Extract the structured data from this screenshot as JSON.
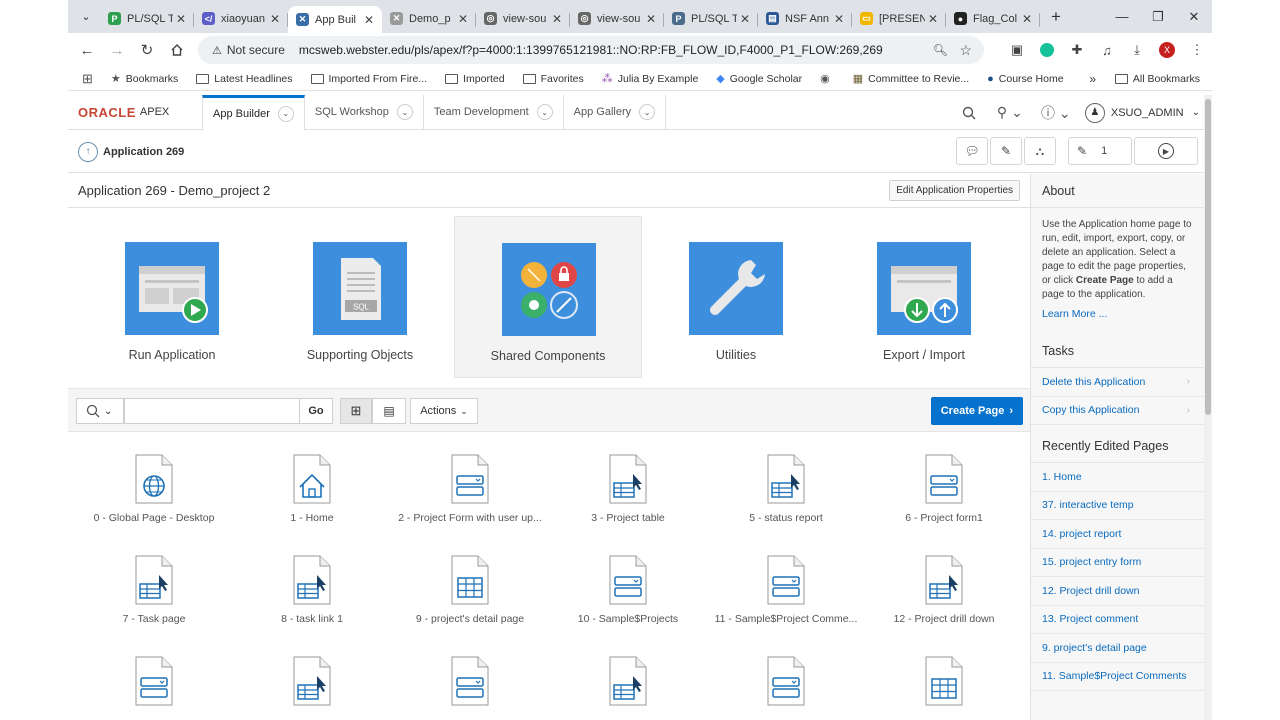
{
  "browser": {
    "tabs": [
      {
        "label": "PL/SQL T",
        "color": "#2e9e4f",
        "glyph": "P"
      },
      {
        "label": "xiaoyuan",
        "color": "#5b5fc7",
        "glyph": "</"
      },
      {
        "label": "App Buil",
        "color": "#3b6ea8",
        "glyph": "✕",
        "active": true
      },
      {
        "label": "Demo_p",
        "color": "#9a9a9a",
        "glyph": "✕"
      },
      {
        "label": "view-sou",
        "color": "#666666",
        "glyph": "◎"
      },
      {
        "label": "view-sou",
        "color": "#666666",
        "glyph": "◎"
      },
      {
        "label": "PL/SQL T",
        "color": "#4a6b8a",
        "glyph": "P"
      },
      {
        "label": "NSF Ann",
        "color": "#2b5797",
        "glyph": "▤"
      },
      {
        "label": "[PRESEN",
        "color": "#f2b700",
        "glyph": "▭"
      },
      {
        "label": "Flag_Col",
        "color": "#222222",
        "glyph": "●"
      }
    ],
    "not_secure": "Not secure",
    "url": "mcsweb.webster.edu/pls/apex/f?p=4000:1:1399765121981::NO:RP:FB_FLOW_ID,F4000_P1_FLOW:269,269",
    "profile_initial": "X",
    "bookmarks": [
      "Bookmarks",
      "Latest Headlines",
      "Imported From Fire...",
      "Imported",
      "Favorites",
      "Julia By Example",
      "Google Scholar",
      "",
      "Committee to Revie...",
      "Course Home"
    ],
    "all_bookmarks": "All Bookmarks"
  },
  "apex": {
    "logo_oracle": "ORACLE",
    "logo_apex": "APEX",
    "nav": [
      "App Builder",
      "SQL Workshop",
      "Team Development",
      "App Gallery"
    ],
    "user": "XSUO_ADMIN",
    "app_name": "Application 269",
    "edit_count": "1",
    "page_title": "Application 269 - Demo_project 2",
    "edit_props": "Edit Application Properties",
    "tiles": [
      "Run Application",
      "Supporting Objects",
      "Shared Components",
      "Utilities",
      "Export / Import"
    ],
    "go": "Go",
    "actions": "Actions",
    "create_page": "Create Page",
    "pages": [
      {
        "label": "0 - Global Page - Desktop",
        "icon": "globe"
      },
      {
        "label": "1 - Home",
        "icon": "home"
      },
      {
        "label": "2 - Project Form with user up...",
        "icon": "form"
      },
      {
        "label": "3 - Project table",
        "icon": "report"
      },
      {
        "label": "5 - status report",
        "icon": "report"
      },
      {
        "label": "6 - Project form1",
        "icon": "form"
      },
      {
        "label": "7 - Task page",
        "icon": "report"
      },
      {
        "label": "8 - task link 1",
        "icon": "report"
      },
      {
        "label": "9 - project's detail page",
        "icon": "grid"
      },
      {
        "label": "10 - Sample$Projects",
        "icon": "form"
      },
      {
        "label": "11 - Sample$Project Comme...",
        "icon": "form"
      },
      {
        "label": "12 - Project drill down",
        "icon": "report"
      },
      {
        "label": "",
        "icon": "form"
      },
      {
        "label": "",
        "icon": "report"
      },
      {
        "label": "",
        "icon": "form"
      },
      {
        "label": "",
        "icon": "report"
      },
      {
        "label": "",
        "icon": "form"
      },
      {
        "label": "",
        "icon": "grid"
      }
    ]
  },
  "sidebar": {
    "about_title": "About",
    "about_pre": "Use the Application home page to run, edit, import, export, copy, or delete an application. Select a page to edit the page properties, or click ",
    "about_bold": "Create Page",
    "about_post": " to add a page to the application.",
    "learn_more": "Learn More ...",
    "tasks_title": "Tasks",
    "tasks": [
      "Delete this Application",
      "Copy this Application"
    ],
    "recent_title": "Recently Edited Pages",
    "recent": [
      "1. Home",
      "37. interactive temp",
      "14. project report",
      "15. project entry form",
      "12. Project drill down",
      "13. Project comment",
      "9. project's detail page",
      "11. Sample$Project Comments"
    ]
  }
}
